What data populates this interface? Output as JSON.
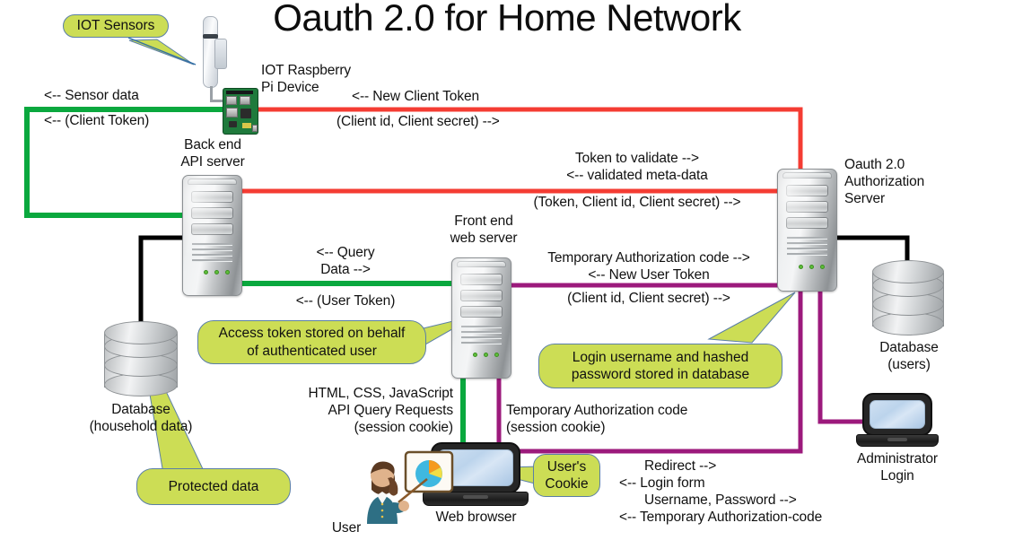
{
  "title": "Oauth 2.0 for Home Network",
  "colors": {
    "green_link": "#0aa83e",
    "red_link": "#f43c33",
    "purple_link": "#9c1a7c",
    "black_link": "#000000",
    "callout_fill": "#ccdd55",
    "callout_border": "#5b7fa6"
  },
  "nodes": {
    "iot_sensors_callout": "IOT Sensors",
    "raspberry_pi": "IOT Raspberry\nPi Device",
    "backend_api_server": "Back end\nAPI server",
    "frontend_web_server": "Front end\nweb server",
    "oauth_server": "Oauth 2.0\nAuthorization\nServer",
    "database_users": "Database\n(users)",
    "database_household": "Database\n(household data)",
    "administrator_login": "Administrator\nLogin",
    "web_browser": "Web browser",
    "user": "User"
  },
  "callouts": {
    "iot_sensors": "IOT Sensors",
    "access_token": "Access token stored on behalf\nof authenticated user",
    "login_username": "Login username and hashed\npassword stored in database",
    "protected_data": "Protected data",
    "users_cookie": "User's\nCookie"
  },
  "flows": {
    "sensor_data": "<-- Sensor data",
    "client_token": "<-- (Client Token)",
    "new_client_token": "<-- New Client Token",
    "client_id_secret_top": "(Client id, Client secret) -->",
    "token_to_validate": "Token to validate -->",
    "validated_meta_data": "<-- validated meta-data",
    "token_client_id_secret": "(Token, Client id, Client secret) -->",
    "query": "<-- Query",
    "data": "Data -->",
    "user_token": "<-- (User Token)",
    "temp_auth_code_arrow": "Temporary Authorization code -->",
    "new_user_token": "<-- New User Token",
    "client_id_secret_mid": "(Client id, Client secret) -->",
    "html_css_js": "HTML, CSS, JavaScript\nAPI Query Requests\n(session cookie)",
    "temp_auth_code_cookie": "Temporary Authorization code\n(session cookie)",
    "redirect": "Redirect -->",
    "login_form": "<-- Login form",
    "username_password": "Username, Password -->",
    "temp_auth_code_resp": "<-- Temporary Authorization-code"
  }
}
